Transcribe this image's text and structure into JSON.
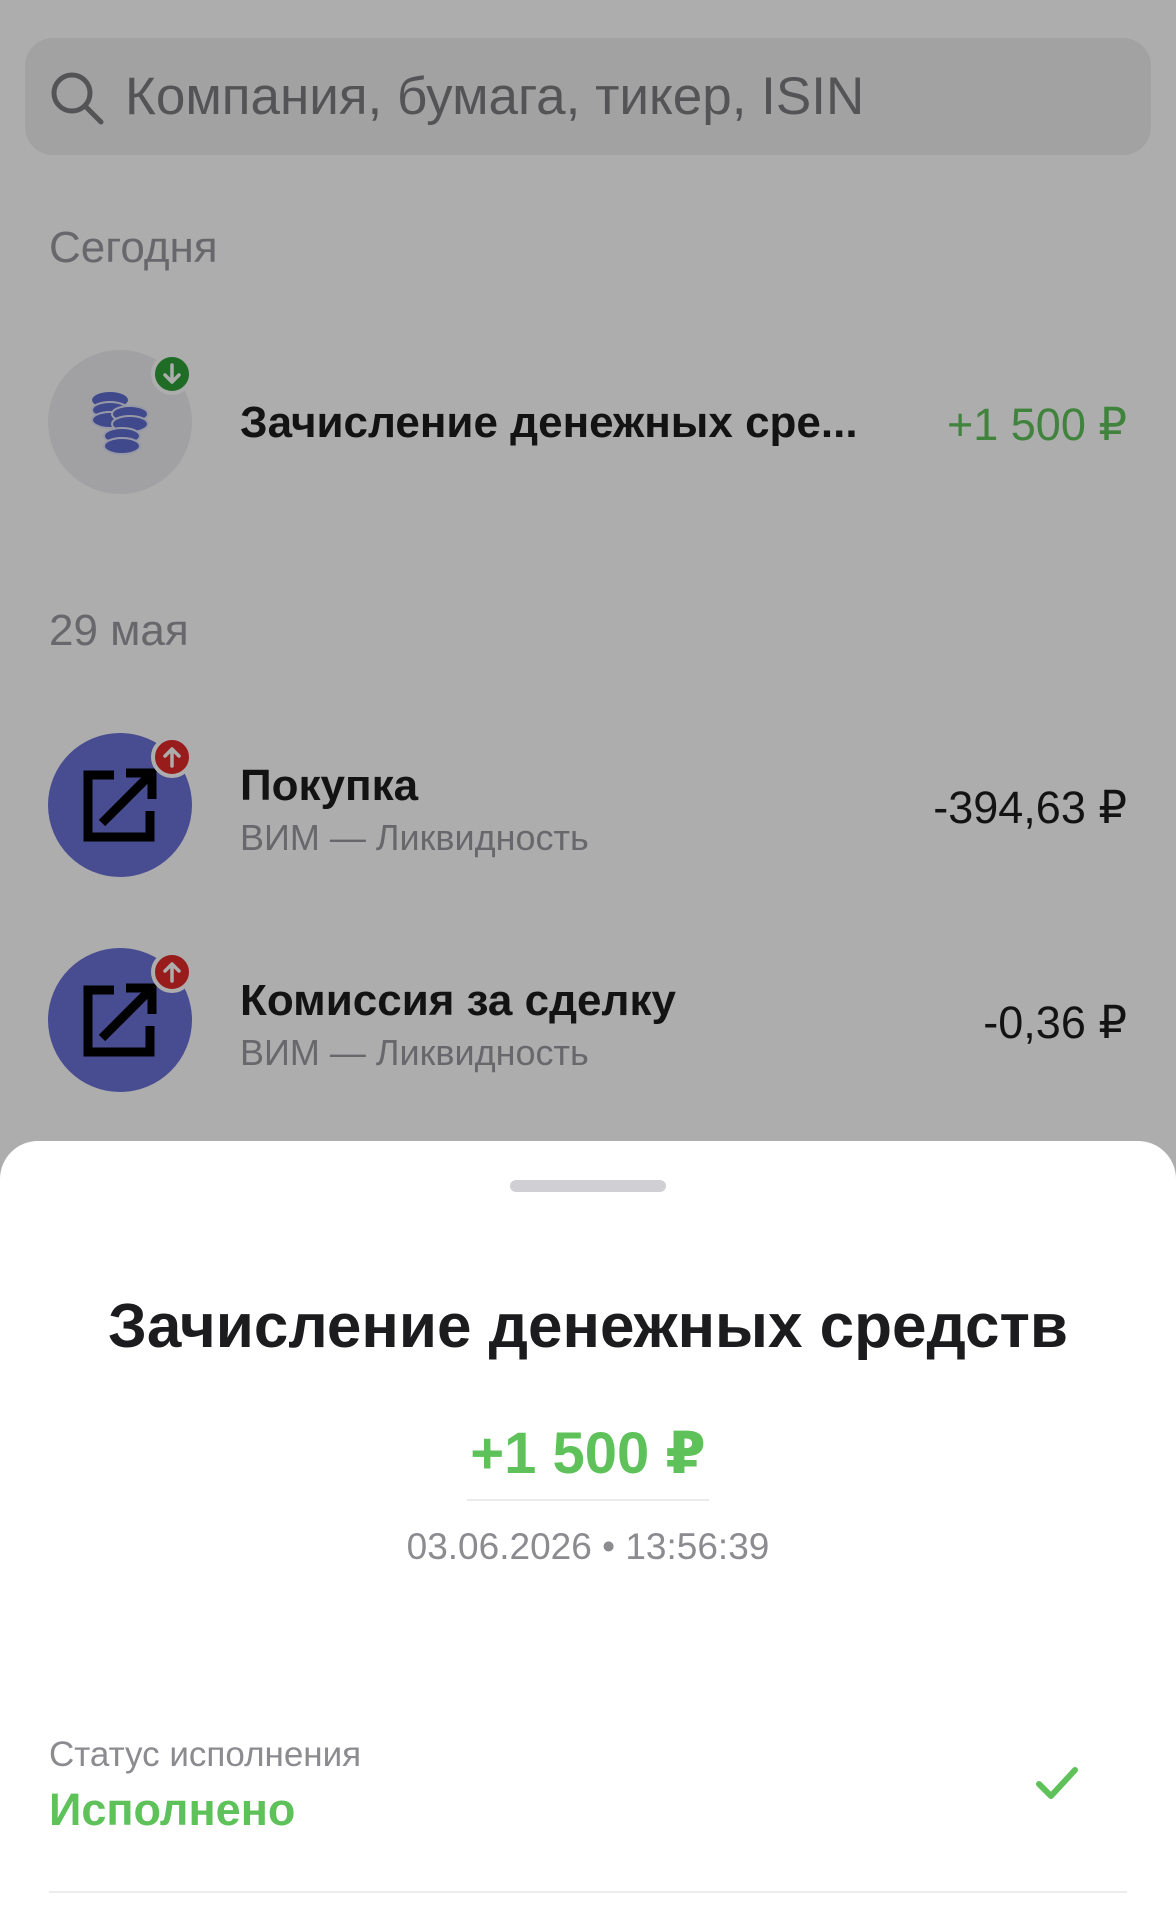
{
  "search": {
    "placeholder": "Компания, бумага, тикер, ISIN"
  },
  "sections": [
    {
      "label": "Сегодня",
      "operations": [
        {
          "title": "Зачисление денежных сре...",
          "subtitle": "",
          "amount": "+1 500 ₽",
          "amount_color": "#5ec15a",
          "icon": "coins-stack-icon",
          "badge": "arrow-down-icon",
          "badge_color": "#2f9f3a"
        }
      ]
    },
    {
      "label": "29 мая",
      "operations": [
        {
          "title": "Покупка",
          "subtitle": "ВИМ — Ликвидность",
          "amount": "-394,63 ₽",
          "amount_color": "#1c1c1e",
          "icon": "external-arrow-icon",
          "badge": "arrow-up-icon",
          "badge_color": "#e02a2a"
        },
        {
          "title": "Комиссия за сделку",
          "subtitle": "ВИМ — Ликвидность",
          "amount": "-0,36 ₽",
          "amount_color": "#1c1c1e",
          "icon": "external-arrow-icon",
          "badge": "arrow-up-icon",
          "badge_color": "#e02a2a"
        }
      ]
    }
  ],
  "sheet": {
    "title": "Зачисление денежных средств",
    "amount": "+1 500 ₽",
    "datetime": "03.06.2026 • 13:56:39",
    "status_label": "Статус исполнения",
    "status_value": "Исполнено",
    "status_icon": "checkmark-icon"
  },
  "colors": {
    "accent_green": "#5ec15a",
    "overlay": "rgba(0,0,0,0.32)",
    "badge_red": "#e02a2a",
    "badge_green": "#2f9f3a"
  }
}
